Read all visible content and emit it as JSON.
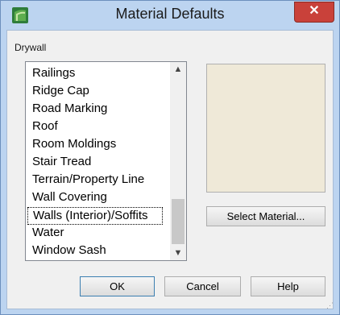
{
  "window": {
    "title": "Material Defaults",
    "close_label": "✕"
  },
  "group": {
    "label": "Drywall"
  },
  "list": {
    "items": [
      "Railings",
      "Ridge Cap",
      "Road Marking",
      "Roof",
      "Room Moldings",
      "Stair Tread",
      "Terrain/Property Line",
      "Wall Covering",
      "Walls (Interior)/Soffits",
      "Water",
      "Window Sash"
    ],
    "selected": "Walls (Interior)/Soffits",
    "scroll_up": "▲",
    "scroll_down": "▼"
  },
  "preview": {
    "color": "#efe9d8"
  },
  "buttons": {
    "select_material": "Select Material...",
    "ok": "OK",
    "cancel": "Cancel",
    "help": "Help"
  },
  "icons": {
    "app": "app-icon",
    "close": "close-icon",
    "resize": "resize-grip-icon"
  }
}
